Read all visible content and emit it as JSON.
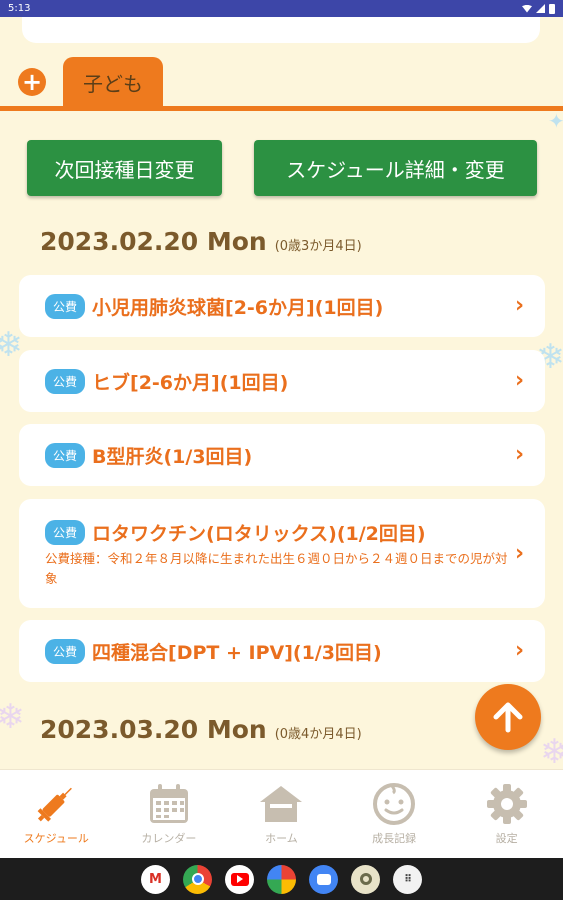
{
  "status_bar": {
    "time": "5:13"
  },
  "tabs": {
    "add_symbol": "+",
    "child_label": "子ども"
  },
  "buttons": {
    "next_date_label": "次回接種日変更",
    "schedule_label": "スケジュール詳細・変更"
  },
  "sections": [
    {
      "date": "2023.02.20 Mon",
      "age": "(0歳3か月4日)",
      "vaccines": [
        {
          "badge": "公費",
          "name": "小児用肺炎球菌[2-6か月](1回目)",
          "note": ""
        },
        {
          "badge": "公費",
          "name": "ヒブ[2-6か月](1回目)",
          "note": ""
        },
        {
          "badge": "公費",
          "name": "B型肝炎(1/3回目)",
          "note": ""
        },
        {
          "badge": "公費",
          "name": "ロタワクチン(ロタリックス)(1/2回目)",
          "note": "公費接種：令和２年８月以降に生まれた出生６週０日から２４週０日までの児が対象"
        },
        {
          "badge": "公費",
          "name": "四種混合[DPT + IPV](1/3回目)",
          "note": ""
        }
      ]
    },
    {
      "date": "2023.03.20 Mon",
      "age": "(0歳4か月4日)",
      "vaccines": []
    }
  ],
  "chevron_symbol": "›",
  "bottom_nav": [
    {
      "label": "スケジュール",
      "icon": "syringe-icon",
      "active": true
    },
    {
      "label": "カレンダー",
      "icon": "calendar-icon",
      "active": false
    },
    {
      "label": "ホーム",
      "icon": "home-icon",
      "active": false
    },
    {
      "label": "成長記録",
      "icon": "baby-face-icon",
      "active": false
    },
    {
      "label": "設定",
      "icon": "gear-icon",
      "active": false
    }
  ],
  "colors": {
    "accent": "#ee7a1e",
    "button_green": "#2c9142",
    "badge_blue": "#4bb2e6",
    "background": "#fdf6dc",
    "date_brown": "#7b5a2c"
  },
  "system_apps": [
    "gmail-icon",
    "chrome-icon",
    "youtube-icon",
    "photos-icon",
    "messages-icon",
    "camera-icon",
    "app-drawer-icon"
  ]
}
